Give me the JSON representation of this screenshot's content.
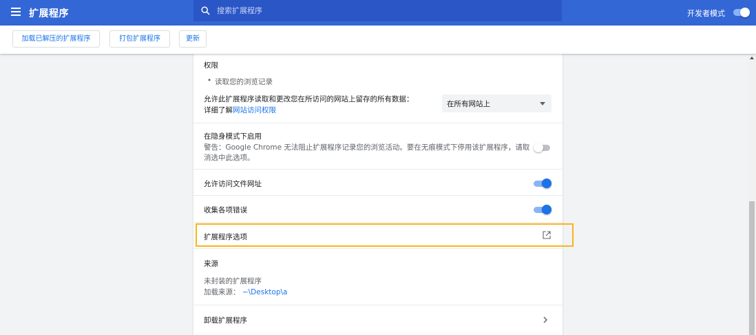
{
  "header": {
    "title": "扩展程序",
    "search_placeholder": "搜索扩展程序",
    "dev_mode_label": "开发者模式",
    "dev_mode_on": true
  },
  "toolbar": {
    "load_unpacked": "加载已解压的扩展程序",
    "pack": "打包扩展程序",
    "update": "更新"
  },
  "permissions": {
    "title": "权限",
    "item": "读取您的浏览记录",
    "bullet": "•"
  },
  "site_access": {
    "text": "允许此扩展程序读取和更改您在所访问的网站上留存的所有数据：",
    "learn_more_prefix": "详细了解",
    "learn_more_link": "网站访问权限",
    "selected": "在所有网站上"
  },
  "incognito": {
    "title": "在隐身模式下启用",
    "warning_line1": "警告：Google Chrome 无法阻止扩展程序记录您的浏览活动。要在无痕模式下停用该扩展程序，请取",
    "warning_line2": "消选中此选项。",
    "enabled": false
  },
  "file_urls": {
    "label": "允许访问文件网址",
    "enabled": true
  },
  "collect_errors": {
    "label": "收集各项错误",
    "enabled": true
  },
  "options": {
    "label": "扩展程序选项"
  },
  "source": {
    "title": "来源",
    "type": "未封装的扩展程序",
    "load_label": "加载来源：",
    "load_path": "~\\Desktop\\a"
  },
  "remove": {
    "label": "卸载扩展程序"
  },
  "colors": {
    "brand": "#3367d6",
    "accent": "#1a73e8",
    "highlight": "#f9b31b"
  }
}
